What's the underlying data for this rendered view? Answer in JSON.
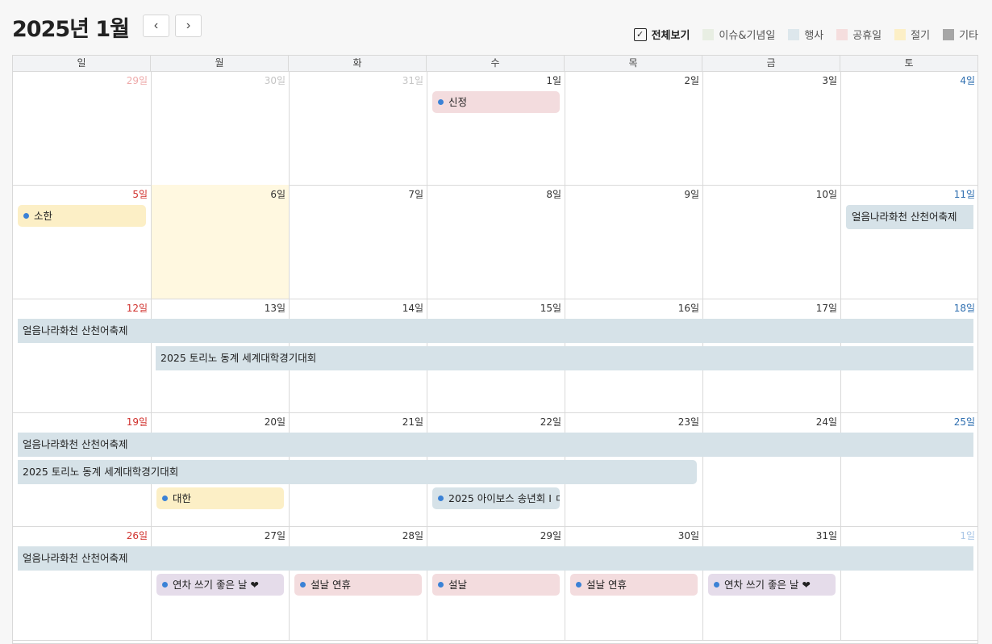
{
  "header": {
    "title": "2025년 1월",
    "prev_label": "‹",
    "next_label": "›"
  },
  "legend": {
    "all_label": "전체보기",
    "all_checked_glyph": "✓",
    "items": [
      {
        "label": "이슈&기념일",
        "color": "#e8eee3"
      },
      {
        "label": "행사",
        "color": "#dde7ec"
      },
      {
        "label": "공휴일",
        "color": "#f5dede"
      },
      {
        "label": "절기",
        "color": "#fcefc6"
      },
      {
        "label": "기타",
        "color": "#a6a6a6"
      }
    ]
  },
  "weekdays": [
    "일",
    "월",
    "화",
    "수",
    "목",
    "금",
    "토"
  ],
  "weeks": [
    {
      "dates": [
        "29일",
        "30일",
        "31일",
        "1일",
        "2일",
        "3일",
        "4일"
      ]
    },
    {
      "dates": [
        "5일",
        "6일",
        "7일",
        "8일",
        "9일",
        "10일",
        "11일"
      ]
    },
    {
      "dates": [
        "12일",
        "13일",
        "14일",
        "15일",
        "16일",
        "17일",
        "18일"
      ]
    },
    {
      "dates": [
        "19일",
        "20일",
        "21일",
        "22일",
        "23일",
        "24일",
        "25일"
      ]
    },
    {
      "dates": [
        "26일",
        "27일",
        "28일",
        "29일",
        "30일",
        "31일",
        "1일"
      ]
    }
  ],
  "events": {
    "sinjeong": "신정",
    "sohan": "소한",
    "festival": "얼음나라화천 산천어축제",
    "festival_w3": "얼음나라화천 산천어축제",
    "universiade_w3": "2025 토리노 동계 세계대학경기대회",
    "festival_w4": "얼음나라화천 산천어축제",
    "universiade_w4": "2025 토리노 동계 세계대학경기대회",
    "daehan": "대한",
    "aivos": "2025 아이보스 송년회 I ㅁ",
    "festival_w5": "얼음나라화천 산천어축제",
    "annual_leave_1": "연차 쓰기 좋은 날 ❤",
    "seollal_holiday_1": "설날 연휴",
    "seollal": "설날",
    "seollal_holiday_2": "설날 연휴",
    "annual_leave_2": "연차 쓰기 좋은 날 ❤"
  }
}
